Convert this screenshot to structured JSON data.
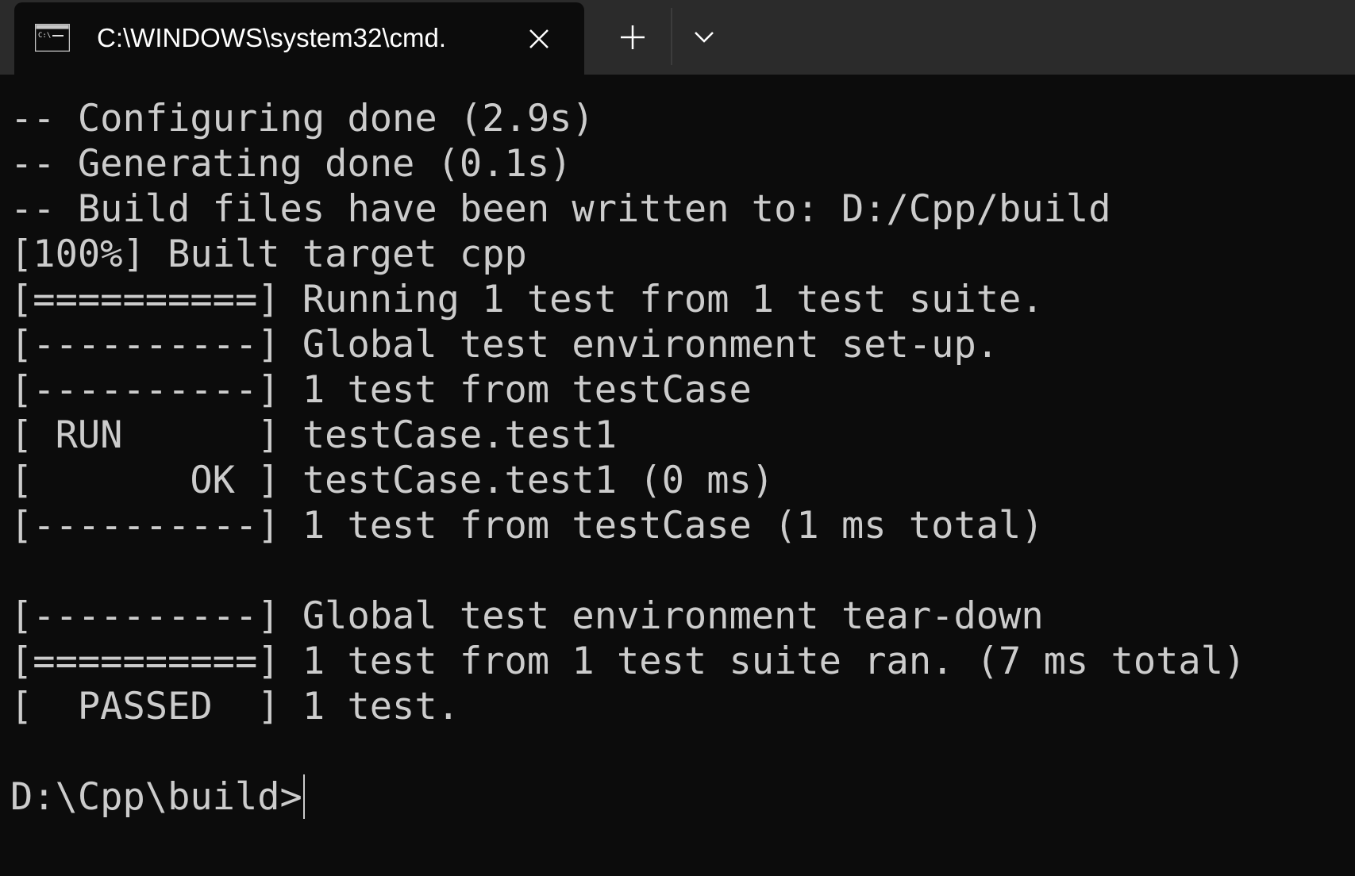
{
  "tab": {
    "title": "C:\\WINDOWS\\system32\\cmd.",
    "icon": "cmd-prompt-icon",
    "icon_text": "C:\\",
    "close_icon": "close-icon",
    "new_tab_icon": "plus-icon",
    "dropdown_icon": "chevron-down-icon"
  },
  "colors": {
    "background": "#0c0c0c",
    "tabbar": "#2b2b2b",
    "text": "#cccccc"
  },
  "terminal": {
    "lines": [
      "-- Configuring done (2.9s)",
      "-- Generating done (0.1s)",
      "-- Build files have been written to: D:/Cpp/build",
      "[100%] Built target cpp",
      "[==========] Running 1 test from 1 test suite.",
      "[----------] Global test environment set-up.",
      "[----------] 1 test from testCase",
      "[ RUN      ] testCase.test1",
      "[       OK ] testCase.test1 (0 ms)",
      "[----------] 1 test from testCase (1 ms total)",
      "",
      "[----------] Global test environment tear-down",
      "[==========] 1 test from 1 test suite ran. (7 ms total)",
      "[  PASSED  ] 1 test."
    ],
    "prompt": "D:\\Cpp\\build>"
  }
}
